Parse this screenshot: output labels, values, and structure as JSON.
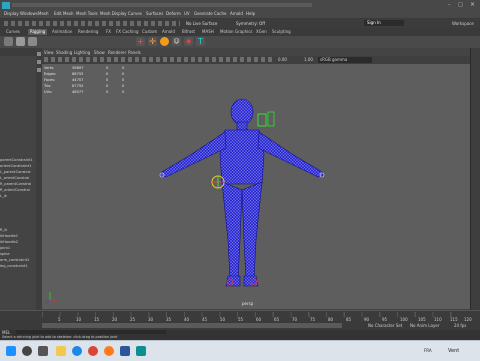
{
  "menubar": {
    "items": [
      "Display",
      "Windows",
      "Mesh",
      "Edit Mesh",
      "Mesh Tools",
      "Mesh Display",
      "Curves",
      "Surfaces",
      "Deform",
      "UV",
      "Generate",
      "Cache",
      "Arnold",
      "Help"
    ],
    "no_live_surface": "No Live Surface",
    "symmetry": "Symmetry: Off",
    "sign_in": "Sign In",
    "workspace": "Workspace"
  },
  "shelf": {
    "tabs": [
      "Curves",
      "Rigging",
      "Animation",
      "Rendering",
      "FX",
      "FX Caching",
      "Custom",
      "Arnold",
      "Bifrost",
      "MASH",
      "Motion Graphics",
      "XGen",
      "Sculpting"
    ],
    "active_tab": "Rigging"
  },
  "outliner": {
    "items": [
      "parentConstraint1",
      "orientConstraint1",
      "L_parentConstrai",
      "L_orientConstrai",
      "R_parentConstrai",
      "R_orientConstrai",
      "L_ik",
      "R_ik",
      "ikHandle1",
      "ikHandle2",
      "joint1",
      "spine",
      "arm_constraint1",
      "leg_constraint1"
    ]
  },
  "viewport": {
    "menu": [
      "View",
      "Shading",
      "Lighting",
      "Show",
      "Renderer",
      "Panels"
    ],
    "hud": {
      "rows": [
        {
          "label": "Verts:",
          "a": "39697",
          "b": "0",
          "c": "0"
        },
        {
          "label": "Edges:",
          "a": "88755",
          "b": "0",
          "c": "0"
        },
        {
          "label": "Faces:",
          "a": "44707",
          "b": "0",
          "c": "0"
        },
        {
          "label": "Tris:",
          "a": "87755",
          "b": "0",
          "c": "0"
        },
        {
          "label": "UVs:",
          "a": "48077",
          "b": "0",
          "c": "0"
        }
      ]
    },
    "camera_label": "persp",
    "toolbar_values": {
      "exposure": "0.00",
      "gamma": "1.00",
      "color_space": "sRGB gamma"
    }
  },
  "timeslider": {
    "ticks": [
      "5",
      "10",
      "15",
      "20",
      "25",
      "30",
      "35",
      "40",
      "45",
      "50",
      "55",
      "60",
      "65",
      "70",
      "75",
      "80",
      "85",
      "90",
      "95",
      "100",
      "105",
      "110",
      "115",
      "120"
    ]
  },
  "rangeslider": {
    "no_character_set": "No Character Set",
    "no_anim_layer": "No Anim Layer",
    "fps": "24 fps"
  },
  "cmdline": {
    "lang": "MEL",
    "help_text": "Select a skinning joint to add to skeleton: click-drag to position joint"
  },
  "taskbar": {
    "weather": "Vent",
    "lang": "FRA",
    "icons": [
      "windows-icon",
      "search-icon",
      "taskview-icon",
      "explorer-icon",
      "edge-icon",
      "chrome-icon",
      "firefox-icon",
      "word-icon",
      "maya-icon"
    ],
    "icon_colors": [
      "#1e90ff",
      "#444444",
      "#555555",
      "#f2c94c",
      "#1e88e5",
      "#db4437",
      "#ff7a1a",
      "#2b579a",
      "#0c8f8f"
    ]
  },
  "colors": {
    "accent": "#2aa6c2",
    "mesh": "#1a1ad8",
    "viewport_bg": "#5e5e5e"
  }
}
